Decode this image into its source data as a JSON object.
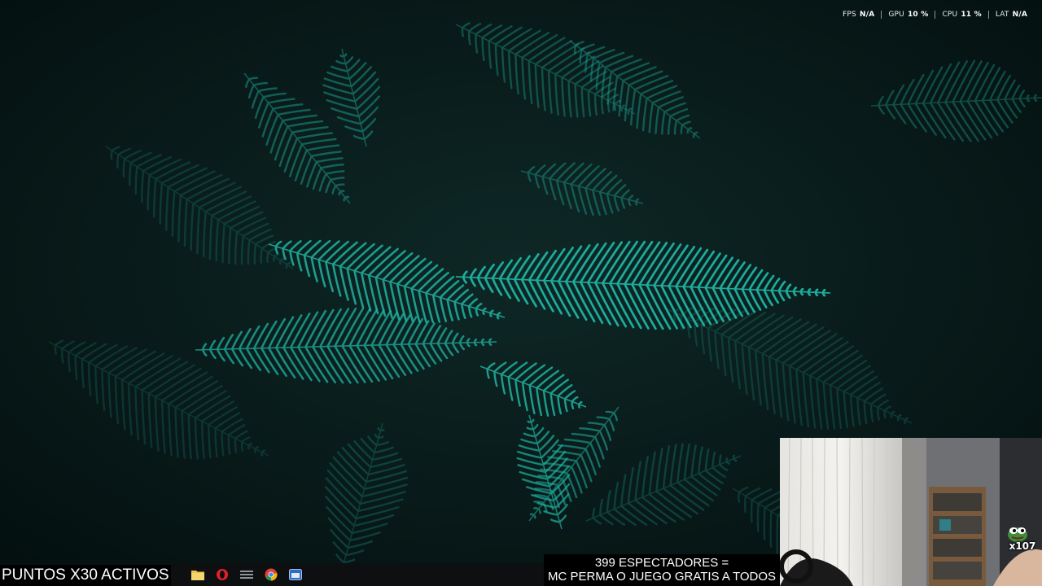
{
  "wallpaper": {
    "subject": "fern-leaves",
    "background_color": "#071716",
    "leaf_color": "#1fb3a3"
  },
  "perf_overlay": {
    "fps": {
      "label": "FPS",
      "value": "N/A"
    },
    "gpu": {
      "label": "GPU",
      "value": "10 %"
    },
    "cpu": {
      "label": "CPU",
      "value": "11 %"
    },
    "lat": {
      "label": "LAT",
      "value": "N/A"
    }
  },
  "stream": {
    "points_banner": "PUNTOS X30 ACTIVOS",
    "viewers_line": "399 ESPECTADORES =",
    "promo_line": "MC PERMA O JUEGO GRATIS A TODOS",
    "emote_count": "x107"
  },
  "taskbar": {
    "apps": [
      {
        "name": "file-explorer-icon"
      },
      {
        "name": "opera-icon"
      },
      {
        "name": "logitech-icon"
      },
      {
        "name": "chrome-icon"
      },
      {
        "name": "app-window-icon"
      }
    ]
  }
}
